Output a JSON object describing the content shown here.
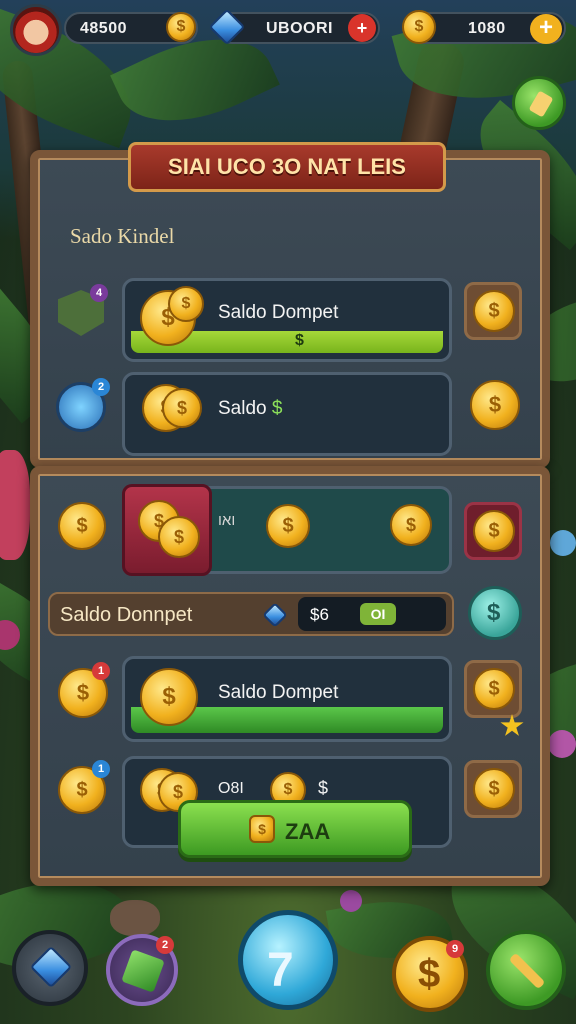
{
  "hud": {
    "coins": "48500",
    "gems": "UBOORI",
    "resource": "1080"
  },
  "panel": {
    "title": "SIAI UCO 3O NAT LEIS",
    "subtitle": "Sado Kindel"
  },
  "rows": [
    {
      "label": "Saldo Dompet",
      "bar_text": "$"
    },
    {
      "label": "Saldo",
      "suffix": "$"
    }
  ],
  "lower": {
    "row1_label": "ואו",
    "wallet_label": "Saldo Donnpet",
    "wallet_amount": "$6",
    "wallet_tag": "OI",
    "row3_label": "Saldo Dompet",
    "row4_left": "O8I",
    "row4_right": "$",
    "button_label": "ZAA"
  },
  "badges": [
    "4",
    "2",
    "1",
    "1",
    "2",
    "9"
  ],
  "colors": {
    "frame": "#7a5638",
    "bar": "#a6d839",
    "banner": "#a83a2c"
  }
}
